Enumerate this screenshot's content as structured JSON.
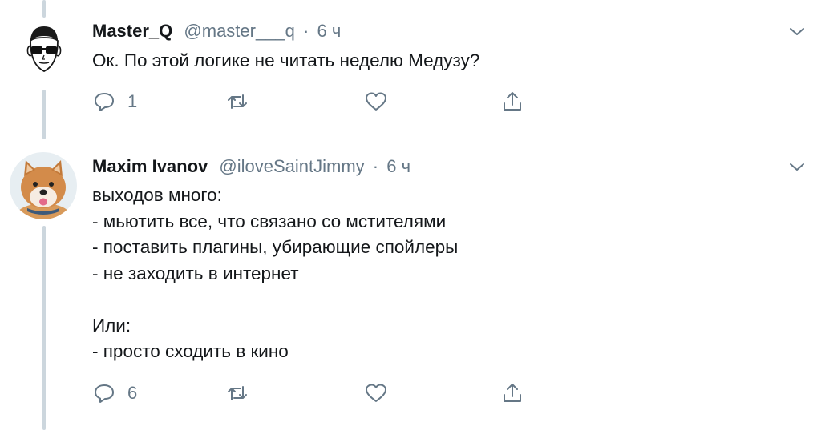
{
  "thread": {
    "tweets": [
      {
        "name": "Master_Q",
        "handle": "@master___q",
        "separator": "·",
        "time": "6 ч",
        "text": "Ок. По этой логике не читать неделю Медузу?",
        "actions": {
          "reply_count": "1",
          "retweet_count": "",
          "like_count": ""
        },
        "avatar_icon": "sunglasses-man-avatar"
      },
      {
        "name": "Maxim Ivanov",
        "handle": "@iloveSaintJimmy",
        "separator": "·",
        "time": "6 ч",
        "text": "выходов много:\n- мьютить все, что связано со мстителями\n- поставить плагины, убирающие спойлеры\n- не заходить в интернет\n\nИли:\n- просто сходить в кино",
        "actions": {
          "reply_count": "6",
          "retweet_count": "",
          "like_count": ""
        },
        "avatar_icon": "shiba-dog-avatar"
      }
    ]
  },
  "colors": {
    "secondary_text": "#657786",
    "thread_line": "#ccd6dd",
    "text": "#14171a"
  }
}
